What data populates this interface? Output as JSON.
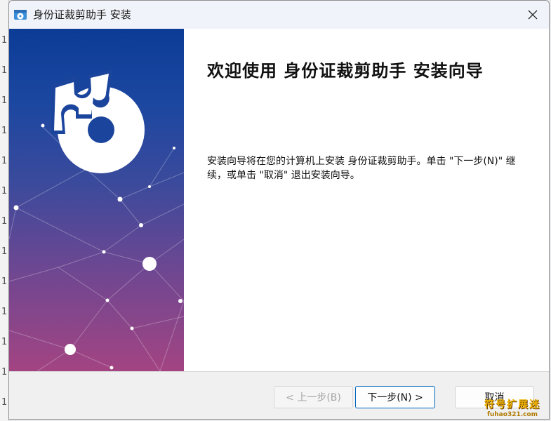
{
  "background": {
    "strip_lines": [
      "1",
      "1",
      "1",
      "1",
      "1",
      "1",
      "1",
      "1",
      "1",
      "1",
      "1",
      "1",
      "1",
      "1"
    ]
  },
  "window": {
    "title": "身份证裁剪助手 安装",
    "icon": "installer-disc-icon",
    "close_icon": "close-icon"
  },
  "main": {
    "heading": "欢迎使用 身份证裁剪助手 安装向导",
    "description": "安装向导将在您的计算机上安装 身份证裁剪助手。单击 \"下一步(N)\" 继续，或单击 \"取消\" 退出安装向导。"
  },
  "side_panel": {
    "logo": "puzzle-disc-logo",
    "gradient_top": "#0b3c96",
    "gradient_bottom": "#a34482"
  },
  "buttons": {
    "back_label": "< 上一步(B)",
    "next_label": "下一步(N) >",
    "cancel_label": "取消"
  },
  "watermark": {
    "line1": "符号扩展迷",
    "line2": "fuhao321.com"
  },
  "colors": {
    "accent": "#0067c0",
    "disabled_text": "#a5a5a5"
  }
}
